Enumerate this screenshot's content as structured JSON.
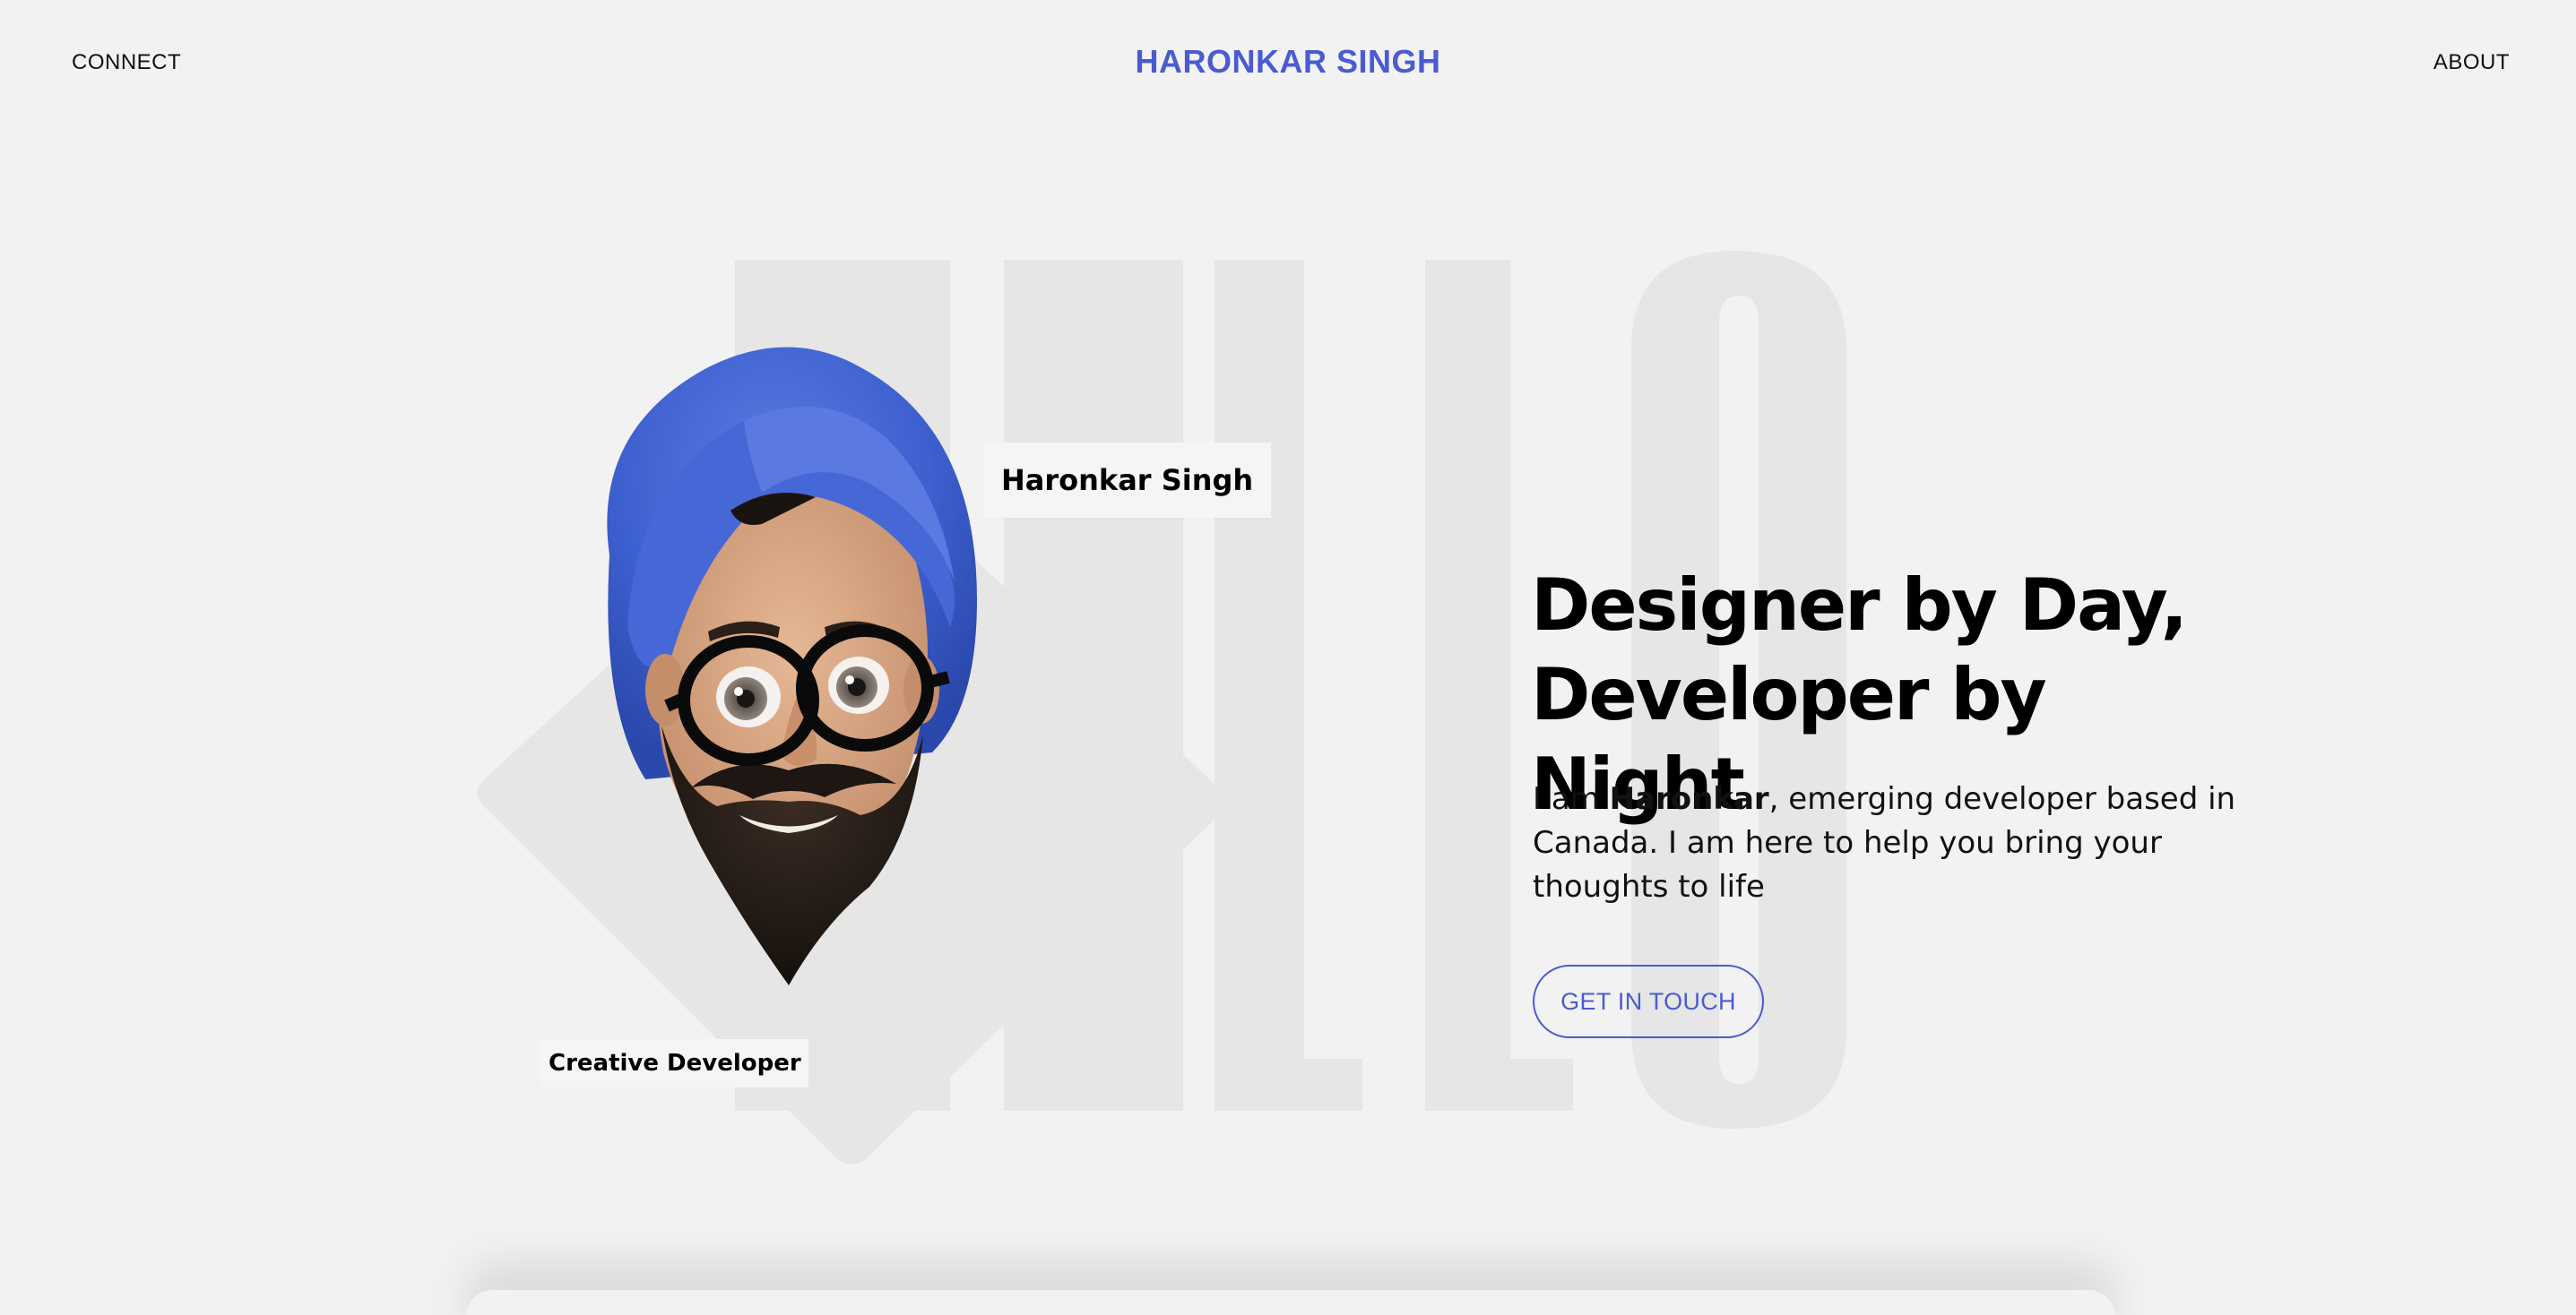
{
  "nav": {
    "connect_label": "CONNECT",
    "brand": "HARONKAR SINGH",
    "about_label": "ABOUT"
  },
  "hero": {
    "background_word": "HELLO",
    "name_tag": "Haronkar Singh",
    "role_tag": "Creative Developer",
    "headline_line1": "Designer by Day,",
    "headline_line2": "Developer by Night",
    "intro_prefix": "I am ",
    "intro_name": "Haronkar",
    "intro_suffix": ", emerging developer based in Canada. I am here to help you bring your thoughts to life",
    "cta_label": "GET IN TOUCH"
  },
  "colors": {
    "background": "#f2f2f2",
    "accent": "#4a5bd2",
    "watermark": "#e6e6e6",
    "text": "#000000"
  }
}
